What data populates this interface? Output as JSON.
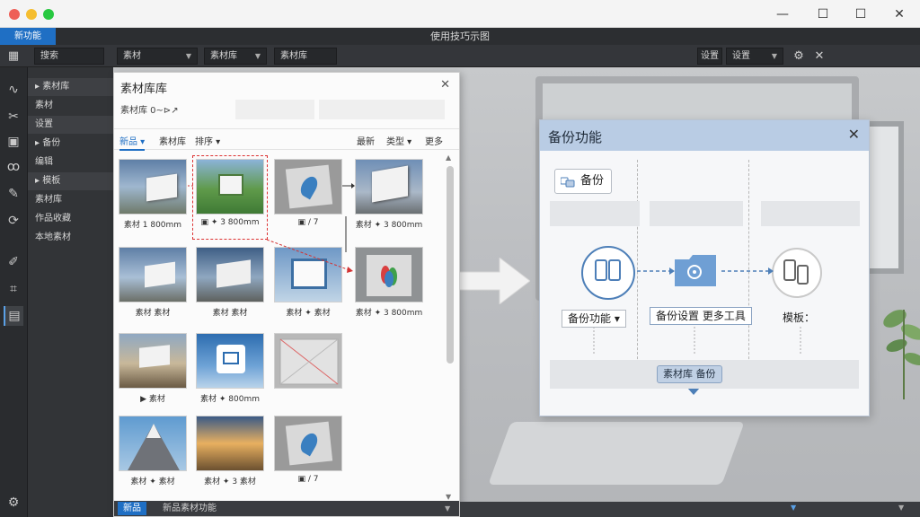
{
  "window": {
    "controls": {
      "minimize": "—",
      "maximize": "☐",
      "close": "✕"
    },
    "traffic_colors": [
      "#ee5f57",
      "#f5bd2f",
      "#27c840"
    ]
  },
  "menubar": {
    "active_tab": "新功能",
    "app_title": "使用技巧示图"
  },
  "toolbar": {
    "search_label": "搜索",
    "filter_select": "素材",
    "material_lib": "素材库",
    "effects": "素材库",
    "right_label": "设置",
    "right_select": "设置"
  },
  "sidebar": {
    "items": [
      {
        "label": "▸ 素材库",
        "highlight": true
      },
      {
        "label": "  素材",
        "highlight": false
      },
      {
        "label": "  设置",
        "highlight": true
      },
      {
        "label": "▸ 备份",
        "highlight": false
      },
      {
        "label": "  编辑",
        "highlight": false
      },
      {
        "label": "▸ 模板",
        "highlight": true
      },
      {
        "label": "素材库",
        "highlight": false
      },
      {
        "label": "作品收藏",
        "highlight": false
      },
      {
        "label": "本地素材",
        "highlight": false
      }
    ]
  },
  "library": {
    "title": "素材库库",
    "close": "✕",
    "subtitle": "素材库  0~⊳↗",
    "filters": {
      "new": "新品 ▾",
      "favorites": "素材库",
      "sort": "排序 ▾",
      "recent": "最新",
      "type": "类型 ▾",
      "more": "更多"
    },
    "thumbs": [
      {
        "caption": "素材 1 800mm"
      },
      {
        "caption": "▣ ✦ 3 800mm"
      },
      {
        "caption": "▣ / 7"
      },
      {
        "caption": "素材 ✦ 3 800mm"
      },
      {
        "caption": "素材 素材"
      },
      {
        "caption": "素材 素材"
      },
      {
        "caption": "素材 ✦ 素材"
      },
      {
        "caption": "素材 ✦ 3 800mm"
      },
      {
        "caption": "▶ 素材"
      },
      {
        "caption": "素材 ✦ 800mm"
      },
      {
        "caption": ""
      },
      {
        "caption": "素材 ✦ 素材"
      },
      {
        "caption": "素材 ✦ 3 素材"
      },
      {
        "caption": "▣ / 7"
      }
    ],
    "status": {
      "left": "新品",
      "text": "新品素材功能"
    }
  },
  "card": {
    "title": "备份功能",
    "close": "✕",
    "chip": "备份",
    "node_left_label": "备份功能 ▾",
    "node_mid_label": "备份设置 更多工具",
    "node_right_label": "模板：",
    "bottom_badge": "素材库 备份"
  },
  "colors": {
    "accent": "#1f6fc4",
    "card_header": "#b9cce4",
    "node_stroke": "#4d7fb8",
    "dashed_red": "#d33333"
  }
}
